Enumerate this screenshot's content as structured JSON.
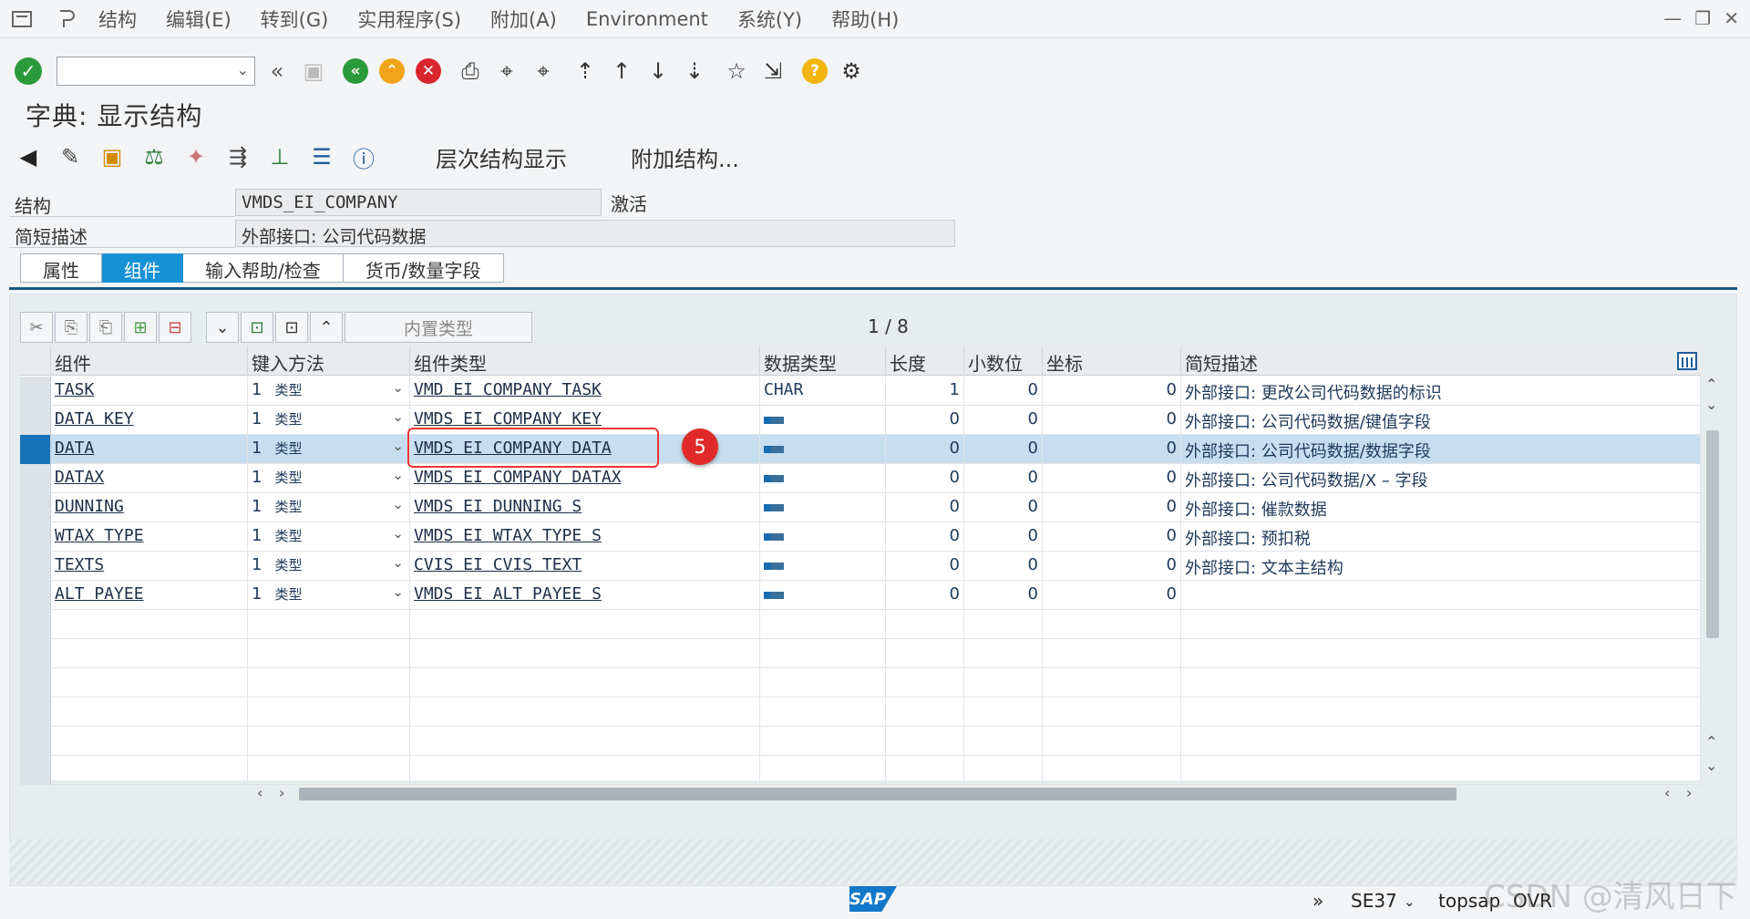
{
  "menubar": {
    "items": [
      "结构",
      "编辑(E)",
      "转到(G)",
      "实用程序(S)",
      "附加(A)",
      "Environment",
      "系统(Y)",
      "帮助(H)"
    ]
  },
  "toolbar": {
    "command_field_value": "",
    "icons": [
      "enter-icon",
      "back-double-icon",
      "save-icon",
      "back-icon",
      "exit-icon",
      "cancel-icon",
      "print-icon",
      "find-icon",
      "find-next-icon",
      "first-page-icon",
      "previous-page-icon",
      "next-page-icon",
      "last-page-icon",
      "create-session-icon",
      "shortcut-icon",
      "help-icon",
      "settings-icon"
    ]
  },
  "page": {
    "title": "字典: 显示结构"
  },
  "app_toolbar": {
    "hierarchy_label": "层次结构显示",
    "append_label": "附加结构..."
  },
  "header": {
    "structure_label": "结构",
    "structure_value": "VMDS_EI_COMPANY",
    "status": "激活",
    "desc_label": "简短描述",
    "desc_value": "外部接口: 公司代码数据"
  },
  "tabs": [
    {
      "label": "属性",
      "active": false
    },
    {
      "label": "组件",
      "active": true
    },
    {
      "label": "输入帮助/检查",
      "active": false
    },
    {
      "label": "货币/数量字段",
      "active": false
    }
  ],
  "table_toolbar": {
    "filter_placeholder": "内置类型",
    "pager": "1 / 8"
  },
  "grid": {
    "columns": [
      "组件",
      "键入方法",
      "组件类型",
      "数据类型",
      "长度",
      "小数位",
      "坐标",
      "简短描述"
    ],
    "rows": [
      {
        "component": "TASK",
        "typing": "1",
        "typing_label": "类型",
        "comp_type": "VMD EI COMPANY TASK",
        "data_type": "CHAR",
        "length": "1",
        "decimals": "0",
        "coord": "0",
        "desc": "外部接口: 更改公司代码数据的标识",
        "selected": false
      },
      {
        "component": "DATA KEY",
        "typing": "1",
        "typing_label": "类型",
        "comp_type": "VMDS EI COMPANY KEY",
        "data_type": "",
        "length": "0",
        "decimals": "0",
        "coord": "0",
        "desc": "外部接口: 公司代码数据/键值字段",
        "selected": false
      },
      {
        "component": "DATA",
        "typing": "1",
        "typing_label": "类型",
        "comp_type": "VMDS EI COMPANY DATA",
        "data_type": "",
        "length": "0",
        "decimals": "0",
        "coord": "0",
        "desc": "外部接口: 公司代码数据/数据字段",
        "selected": true
      },
      {
        "component": "DATAX",
        "typing": "1",
        "typing_label": "类型",
        "comp_type": "VMDS EI COMPANY DATAX",
        "data_type": "",
        "length": "0",
        "decimals": "0",
        "coord": "0",
        "desc": "外部接口: 公司代码数据/X – 字段",
        "selected": false
      },
      {
        "component": "DUNNING",
        "typing": "1",
        "typing_label": "类型",
        "comp_type": "VMDS EI DUNNING S",
        "data_type": "",
        "length": "0",
        "decimals": "0",
        "coord": "0",
        "desc": "外部接口: 催款数据",
        "selected": false
      },
      {
        "component": "WTAX TYPE",
        "typing": "1",
        "typing_label": "类型",
        "comp_type": "VMDS EI WTAX TYPE S",
        "data_type": "",
        "length": "0",
        "decimals": "0",
        "coord": "0",
        "desc": "外部接口: 预扣税",
        "selected": false
      },
      {
        "component": "TEXTS",
        "typing": "1",
        "typing_label": "类型",
        "comp_type": "CVIS EI CVIS TEXT",
        "data_type": "",
        "length": "0",
        "decimals": "0",
        "coord": "0",
        "desc": "外部接口: 文本主结构",
        "selected": false
      },
      {
        "component": "ALT PAYEE",
        "typing": "1",
        "typing_label": "类型",
        "comp_type": "VMDS EI ALT PAYEE S",
        "data_type": "",
        "length": "0",
        "decimals": "0",
        "coord": "0",
        "desc": "",
        "selected": false
      }
    ],
    "annotation_number": "5"
  },
  "statusbar": {
    "logo": "SAP",
    "transaction": "SE37",
    "system": "topsap",
    "mode": "OVR"
  },
  "watermark": "CSDN @清风日下",
  "colors": {
    "accent": "#1791d6",
    "selected_row": "#c6def0",
    "annotation": "#e02a2a",
    "ok_green": "#2b9a3a"
  }
}
